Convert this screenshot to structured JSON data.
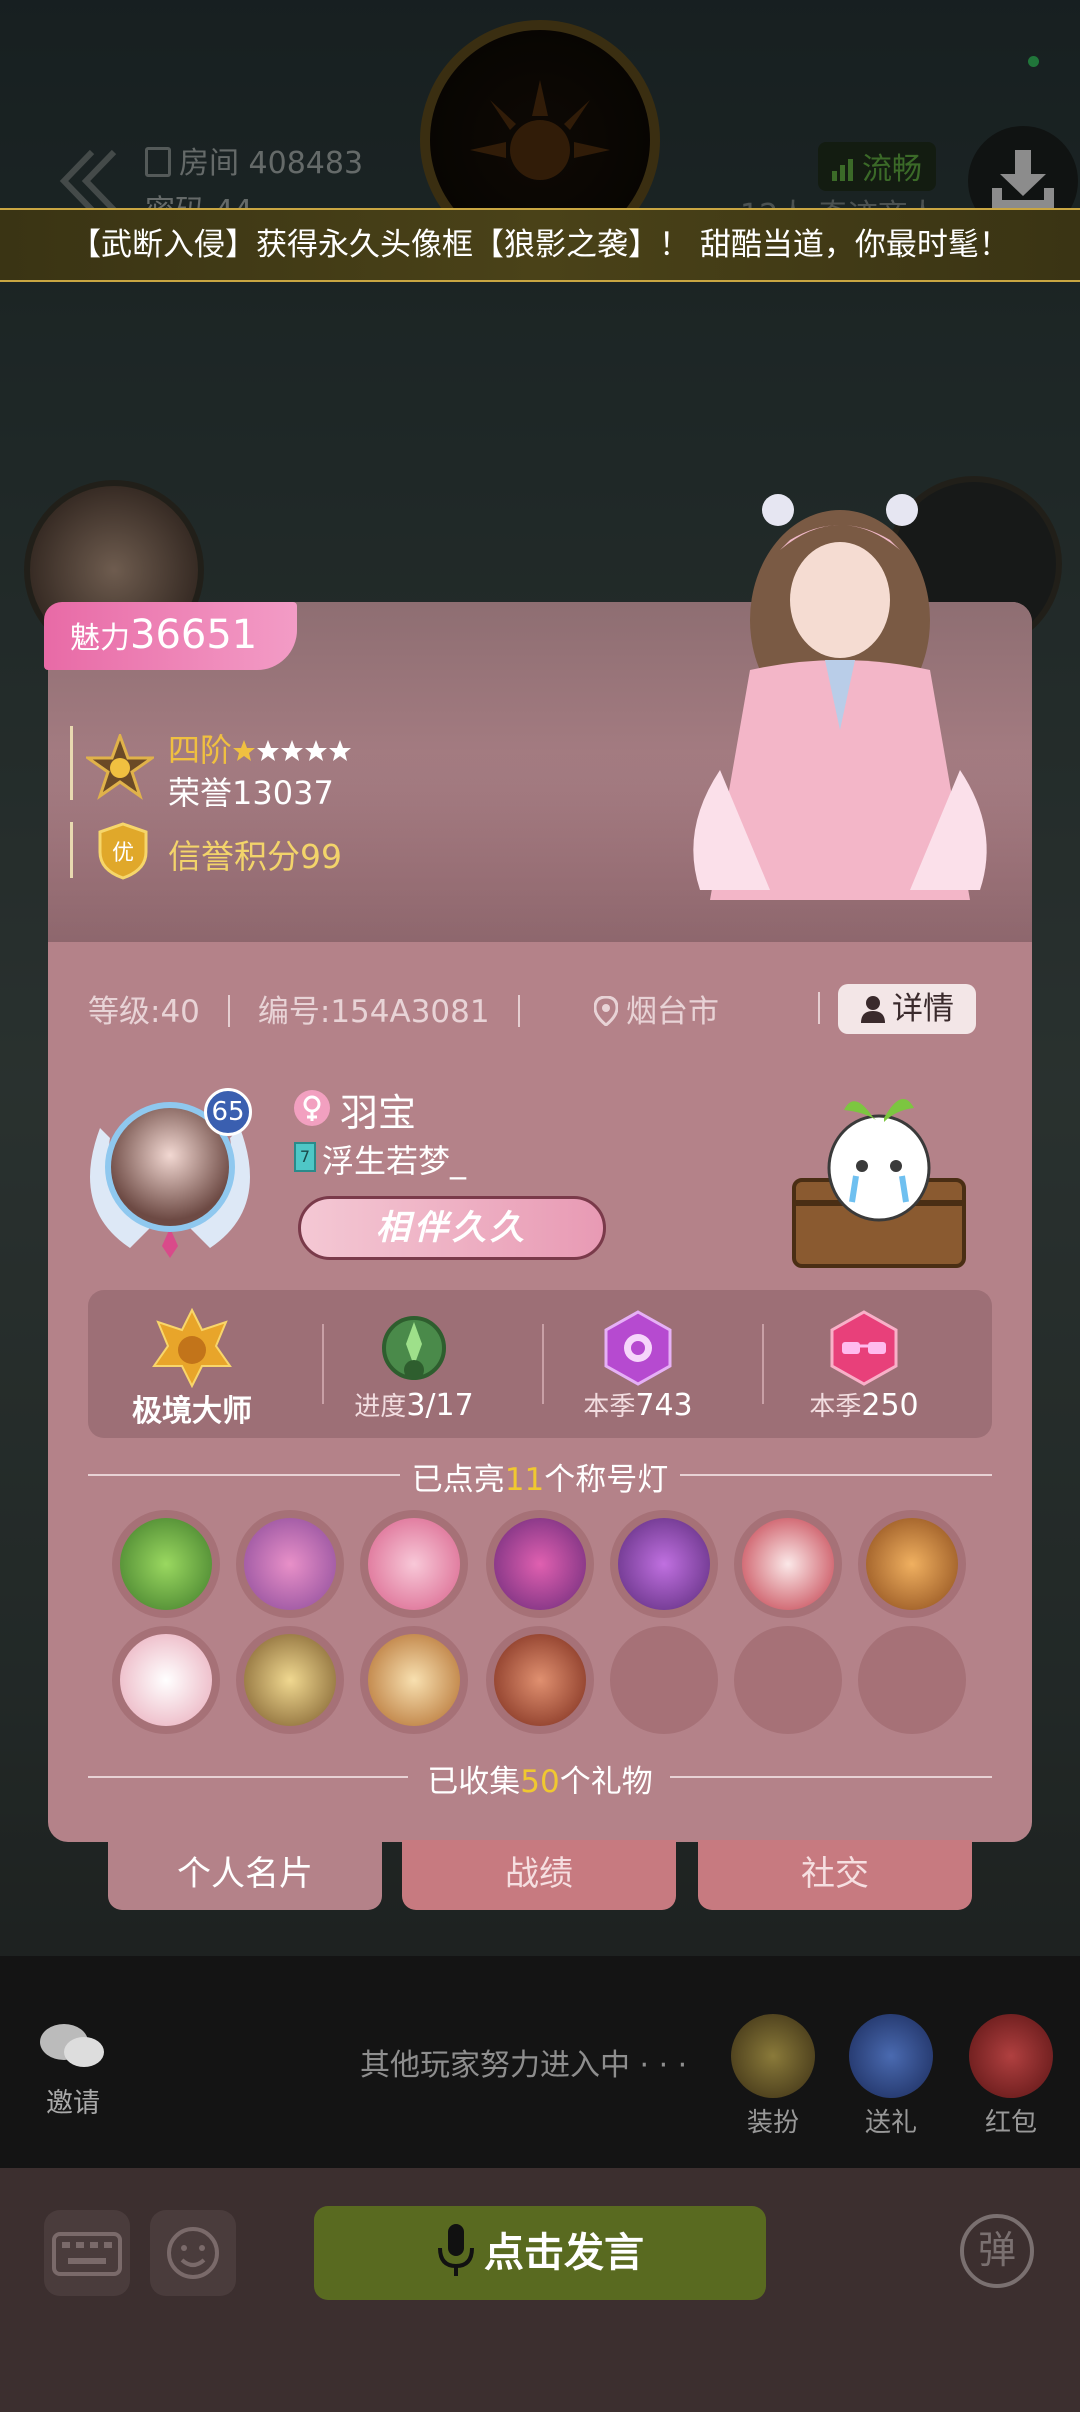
{
  "header": {
    "room_label": "房间 408483",
    "password_label": "密码 44",
    "network_status": "流畅",
    "room_subtitle": "12人 奇迹商人"
  },
  "banner": {
    "text": "【武断入侵】获得永久头像框【狼影之袭】！ 甜酷当道，你最时髦！"
  },
  "profile": {
    "charm_label": "魅力",
    "charm_value": "36651",
    "rank_tier": "四阶",
    "rank_stars": 5,
    "honor": "荣誉13037",
    "credit_badge": "优",
    "credit": "信誉积分99",
    "level": "等级:40",
    "id": "编号:154A3081",
    "location": "烟台市",
    "detail_button": "详情",
    "avatar_level": "65",
    "nickname": "羽宝",
    "guild_level": "7",
    "guild_name": "浮生若梦_",
    "bond_tag": "相伴久久"
  },
  "stats": [
    {
      "label": "极境大师",
      "prefix": "",
      "icon": "golden-lion-emblem-icon"
    },
    {
      "label": "3/17",
      "prefix": "进度",
      "icon": "green-wreath-emblem-icon"
    },
    {
      "label": "743",
      "prefix": "本季",
      "icon": "purple-rose-gem-icon"
    },
    {
      "label": "250",
      "prefix": "本季",
      "icon": "pink-sunglasses-gem-icon"
    }
  ],
  "title_lamps": {
    "prefix": "已点亮",
    "count": "11",
    "suffix": "个称号灯",
    "lit": 11,
    "total": 14
  },
  "gifts": {
    "prefix": "已收集",
    "count": "50",
    "suffix": "个礼物"
  },
  "tabs": [
    "个人名片",
    "战绩",
    "社交"
  ],
  "bottom": {
    "invite_label": "邀请",
    "waiting_text": "其他玩家努力进入中 · · ·",
    "actions": [
      "装扮",
      "送礼",
      "红包"
    ],
    "speak_button": "点击发言",
    "barrage_label": "弹"
  },
  "colors": {
    "card_bg": "#b48289",
    "charm_pink": "#e86aa6",
    "highlight_yellow": "#f0c830",
    "speak_green": "#596a20"
  }
}
